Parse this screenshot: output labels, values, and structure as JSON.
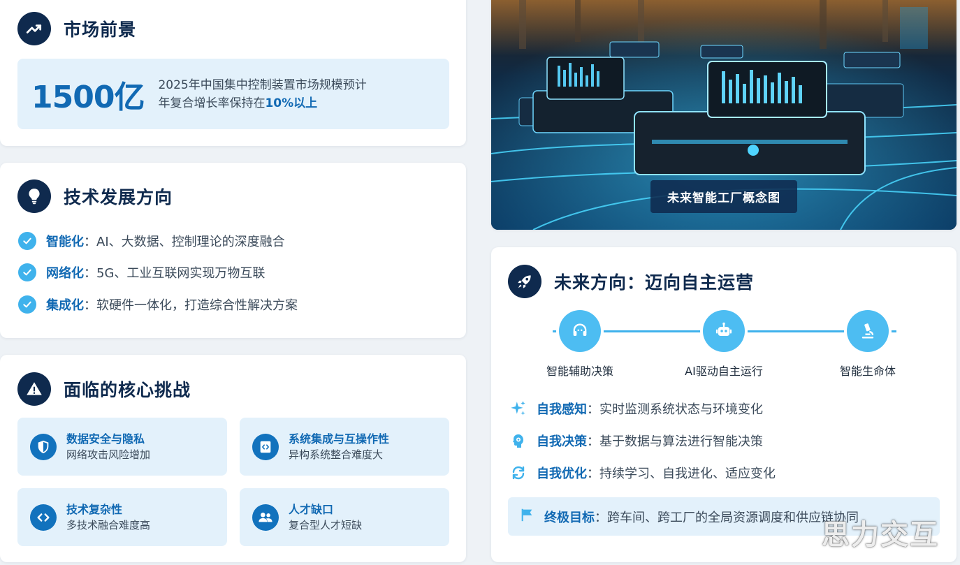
{
  "market": {
    "title": "市场前景",
    "icon": "trending-up-icon",
    "big_number": "1500亿",
    "line1": "2025年中国集中控制装置市场规模预计",
    "line2_prefix": "年复合增长率保持在",
    "line2_highlight": "10%以上"
  },
  "tech": {
    "title": "技术发展方向",
    "icon": "lightbulb-icon",
    "items": [
      {
        "key": "智能化",
        "sep": "：",
        "text": "AI、大数据、控制理论的深度融合"
      },
      {
        "key": "网络化",
        "sep": "：",
        "text": "5G、工业互联网实现万物互联"
      },
      {
        "key": "集成化",
        "sep": "：",
        "text": "软硬件一体化，打造综合性解决方案"
      }
    ]
  },
  "challenges": {
    "title": "面临的核心挑战",
    "icon": "warning-icon",
    "items": [
      {
        "title": "数据安全与隐私",
        "desc": "网络攻击风险增加",
        "icon": "shield-icon"
      },
      {
        "title": "系统集成与互操作性",
        "desc": "异构系统整合难度大",
        "icon": "code-file-icon"
      },
      {
        "title": "技术复杂性",
        "desc": "多技术融合难度高",
        "icon": "code-icon"
      },
      {
        "title": "人才缺口",
        "desc": "复合型人才短缺",
        "icon": "users-icon"
      }
    ]
  },
  "image": {
    "caption": "未来智能工厂概念图"
  },
  "future": {
    "title": "未来方向：迈向自主运营",
    "icon": "rocket-icon",
    "stages": [
      {
        "label": "智能辅助决策",
        "icon": "headset-icon"
      },
      {
        "label": "AI驱动自主运行",
        "icon": "robot-icon"
      },
      {
        "label": "智能生命体",
        "icon": "microscope-icon"
      }
    ],
    "features": [
      {
        "key": "自我感知",
        "sep": "：",
        "text": "实时监测系统状态与环境变化",
        "icon": "sparkles-icon"
      },
      {
        "key": "自我决策",
        "sep": "：",
        "text": "基于数据与算法进行智能决策",
        "icon": "brain-gear-icon"
      },
      {
        "key": "自我优化",
        "sep": "：",
        "text": "持续学习、自我进化、适应变化",
        "icon": "refresh-icon"
      }
    ],
    "goal": {
      "key": "终极目标",
      "sep": "：",
      "text": "跨车间、跨工厂的全局资源调度和供应链协同",
      "icon": "flag-icon"
    }
  },
  "watermark": "思力交互",
  "colors": {
    "navy": "#0f2a4e",
    "accent_blue": "#1169b3",
    "light_blue_bg": "#e3f1fb",
    "cyan": "#3fb2ec"
  }
}
